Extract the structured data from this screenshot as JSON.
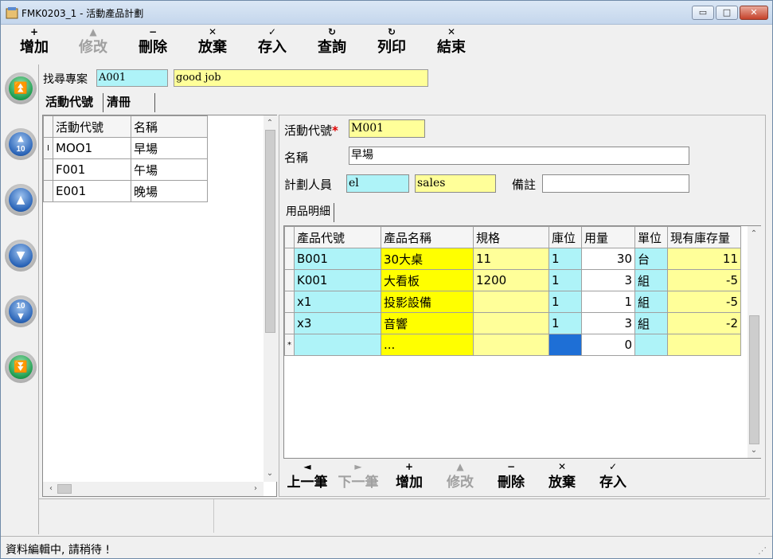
{
  "window": {
    "title": "FMK0203_1 - 活動產品計劃",
    "min": "▭",
    "max": "□",
    "close": "✕"
  },
  "toolbar": [
    {
      "name": "add",
      "sym": "+",
      "label": "增加",
      "enabled": true
    },
    {
      "name": "edit",
      "sym": "▲",
      "label": "修改",
      "enabled": false
    },
    {
      "name": "delete",
      "sym": "−",
      "label": "刪除",
      "enabled": true
    },
    {
      "name": "discard",
      "sym": "✕",
      "label": "放棄",
      "enabled": true
    },
    {
      "name": "save",
      "sym": "✓",
      "label": "存入",
      "enabled": true
    },
    {
      "name": "query",
      "sym": "↻",
      "label": "查詢",
      "enabled": true
    },
    {
      "name": "print",
      "sym": "↻",
      "label": "列印",
      "enabled": true
    },
    {
      "name": "exit",
      "sym": "✕",
      "label": "結束",
      "enabled": true
    }
  ],
  "nav": {
    "first": "⏫",
    "prev10": "10",
    "prev": "▲",
    "next": "▼",
    "next10": "10",
    "last": "⏬"
  },
  "search": {
    "label": "找尋專案",
    "code": "A001",
    "name": "good job"
  },
  "left_tabs": [
    "活動代號",
    "清冊"
  ],
  "activity_list": {
    "headers": [
      "活動代號",
      "名稱"
    ],
    "rows": [
      {
        "marker": "I",
        "code": "MOO1",
        "name": "早場"
      },
      {
        "marker": "",
        "code": "F001",
        "name": "午場"
      },
      {
        "marker": "",
        "code": "E001",
        "name": "晚場"
      }
    ]
  },
  "form": {
    "code_label": "活動代號",
    "required_mark": "*",
    "code_value": "M001",
    "name_label": "名稱",
    "name_value": "早場",
    "planner_label": "計劃人員",
    "planner_code": "el",
    "planner_name": "sales",
    "remark_label": "備註",
    "remark_value": ""
  },
  "detail_tab": "用品明細",
  "detail_grid": {
    "headers": [
      "產品代號",
      "產品名稱",
      "規格",
      "庫位",
      "用量",
      "單位",
      "現有庫存量"
    ],
    "rows": [
      {
        "code": "B001",
        "name": "30大桌",
        "spec": "11",
        "loc": "1",
        "qty": "30",
        "unit": "台",
        "stock": "11"
      },
      {
        "code": "K001",
        "name": "大看板",
        "spec": "1200",
        "loc": "1",
        "qty": "3",
        "unit": "組",
        "stock": "-5"
      },
      {
        "code": "x1",
        "name": "投影設備",
        "spec": "",
        "loc": "1",
        "qty": "1",
        "unit": "組",
        "stock": "-5"
      },
      {
        "code": "x3",
        "name": "音響",
        "spec": "",
        "loc": "1",
        "qty": "3",
        "unit": "組",
        "stock": "-2"
      }
    ],
    "new_row": {
      "marker": "*",
      "name": "...",
      "qty": "0"
    }
  },
  "detail_toolbar": [
    {
      "name": "prev-record",
      "sym": "◄",
      "label": "上一筆",
      "enabled": true
    },
    {
      "name": "next-record",
      "sym": "►",
      "label": "下一筆",
      "enabled": false
    },
    {
      "name": "add",
      "sym": "+",
      "label": "增加",
      "enabled": true
    },
    {
      "name": "edit",
      "sym": "▲",
      "label": "修改",
      "enabled": false
    },
    {
      "name": "delete",
      "sym": "−",
      "label": "刪除",
      "enabled": true
    },
    {
      "name": "discard",
      "sym": "✕",
      "label": "放棄",
      "enabled": true
    },
    {
      "name": "save",
      "sym": "✓",
      "label": "存入",
      "enabled": true
    }
  ],
  "status": {
    "text": "資料編輯中, 請稍待 !"
  },
  "colors": {
    "cyan": "#aef3f8",
    "yellow": "#ffff99",
    "bright_yellow": "#ffff00",
    "selected": "#1e6fd6"
  }
}
